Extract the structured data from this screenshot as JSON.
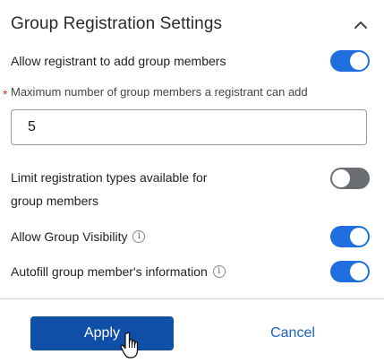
{
  "section": {
    "title": "Group Registration Settings",
    "collapse_icon": "chevron-up-icon"
  },
  "settings": {
    "allow_add_members": {
      "label": "Allow registrant to add group members",
      "enabled": true
    },
    "max_members": {
      "required_marker": "*",
      "label": "Maximum number of group members a registrant can add",
      "value": "5"
    },
    "limit_types": {
      "label_line1": "Limit registration types available for",
      "label_line2": "group members",
      "enabled": false
    },
    "group_visibility": {
      "label": "Allow Group Visibility",
      "info_icon": "info-icon",
      "enabled": true
    },
    "autofill": {
      "label": "Autofill group member's information",
      "info_icon": "info-icon",
      "enabled": true
    }
  },
  "footer": {
    "apply_label": "Apply",
    "cancel_label": "Cancel"
  },
  "colors": {
    "toggle_on": "#1f6fe0",
    "toggle_off": "#6a6d72",
    "primary_button": "#0f4fa8",
    "link": "#1a5fc8",
    "required": "#c8381f"
  }
}
